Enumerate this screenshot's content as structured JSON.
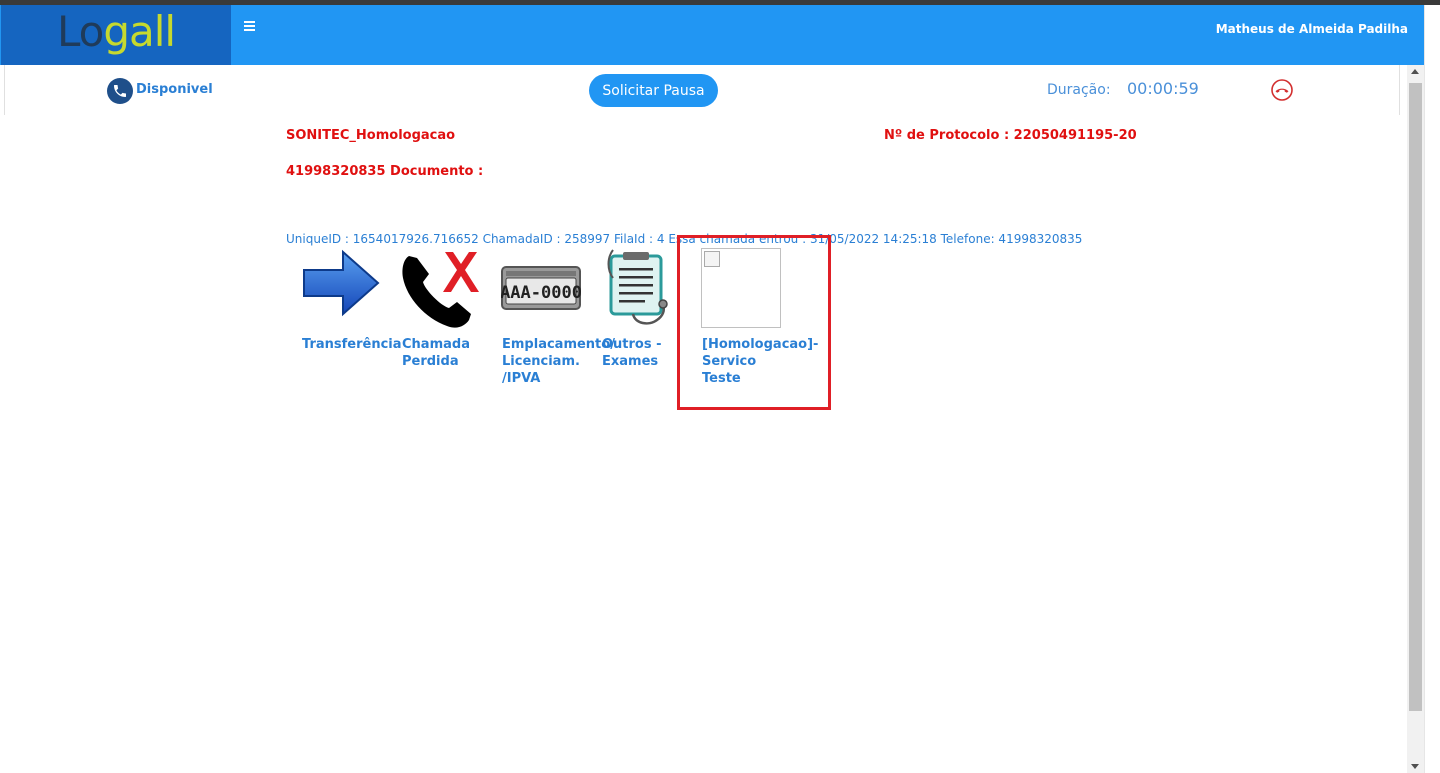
{
  "app": {
    "logo_text_dark": "Lo",
    "logo_text_accent": "gall",
    "menu_icon": "hamburger-icon",
    "user_name": "Matheus de Almeida Padilha"
  },
  "status": {
    "phone_icon": "phone-icon",
    "text": "Disponivel",
    "pause_button": "Solicitar Pausa",
    "duration_label": "Duração:",
    "duration_value": "00:00:59",
    "hangup_icon": "hang-up-icon"
  },
  "call": {
    "queue_name": "SONITEC_Homologacao",
    "protocol": "Nº de Protocolo : 22050491195-20",
    "phone_document": "41998320835 Documento :",
    "unique_info": "UniqueID : 1654017926.716652 ChamadaID : 258997 FilaId : 4  Essa chamada entrou : 31/05/2022 14:25:18 Telefone: 41998320835"
  },
  "actions": [
    {
      "icon": "arrow-right-icon",
      "label_lines": [
        "Transferência"
      ]
    },
    {
      "icon": "missed-call-icon",
      "label_lines": [
        "Chamada",
        "Perdida"
      ]
    },
    {
      "icon": "license-plate-icon",
      "plate_text": "AAA-0000",
      "label_lines": [
        "Emplacamento/",
        "Licenciam.",
        "/IPVA"
      ]
    },
    {
      "icon": "clipboard-stethoscope-icon",
      "label_lines": [
        "Outros -",
        "Exames"
      ]
    },
    {
      "icon": "broken-image-icon",
      "label_lines": [
        "[Homologacao]-",
        "Servico",
        "Teste"
      ]
    }
  ],
  "colors": {
    "navbar": "#2196f3",
    "logo_bg": "#1565c0",
    "alert_red": "#e01010",
    "link_blue": "#2a7fd4"
  }
}
